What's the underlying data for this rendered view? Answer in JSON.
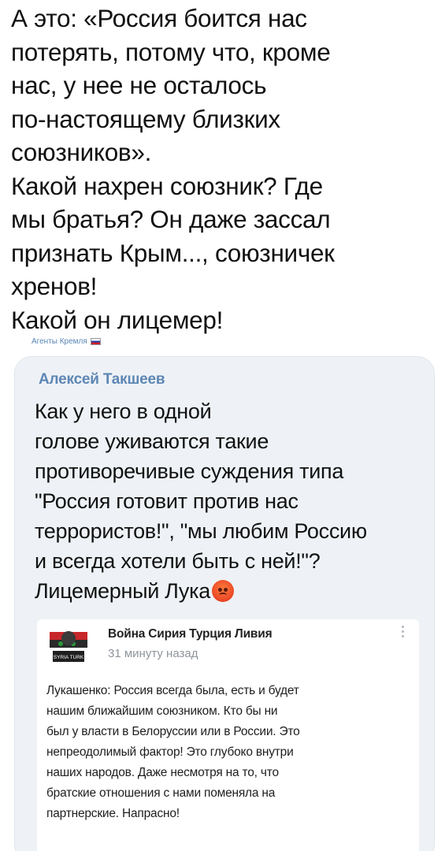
{
  "post": {
    "lines": [
      "А это: «Россия боится нас",
      "потерять, потому что, кроме",
      "нас, у нее не осталось",
      "по-настоящему близких",
      "союзников».",
      "Какой нахрен союзник? Где",
      "мы братья? Он даже зассал",
      "признать Крым..., союзничек",
      "хренов!",
      "Какой он лицемер!"
    ],
    "source": "Агенты Кремля"
  },
  "reply": {
    "author": "Алексей Такшеев",
    "lines": [
      "Как у него в одной",
      "голове уживаются такие",
      "противоречивые суждения типа",
      "\"Россия готовит против нас",
      "террористов!\", \"мы любим Россию",
      "и всегда хотели быть с ней!\"?",
      "Лицемерный Лука"
    ],
    "emoji": "angry-face-icon"
  },
  "quoted": {
    "group_name": "Война Сирия Турция Ливия",
    "time": "31 минуту назад",
    "avatar_label": "SYRIA TURK",
    "lines": [
      "Лукашенко: Россия всегда была, есть и будет",
      "нашим ближайшим союзником. Кто бы ни",
      "был у власти в Белоруссии или в России. Это",
      "непреодолимый фактор! Это глубоко внутри",
      "наших народов. Даже несмотря на то, что",
      "братские отношения с нами поменяла на",
      "партнерские. Напрасно!"
    ]
  },
  "colors": {
    "author": "#5d86b4",
    "card_bg": "#eef2f6",
    "time": "#8f959c"
  }
}
